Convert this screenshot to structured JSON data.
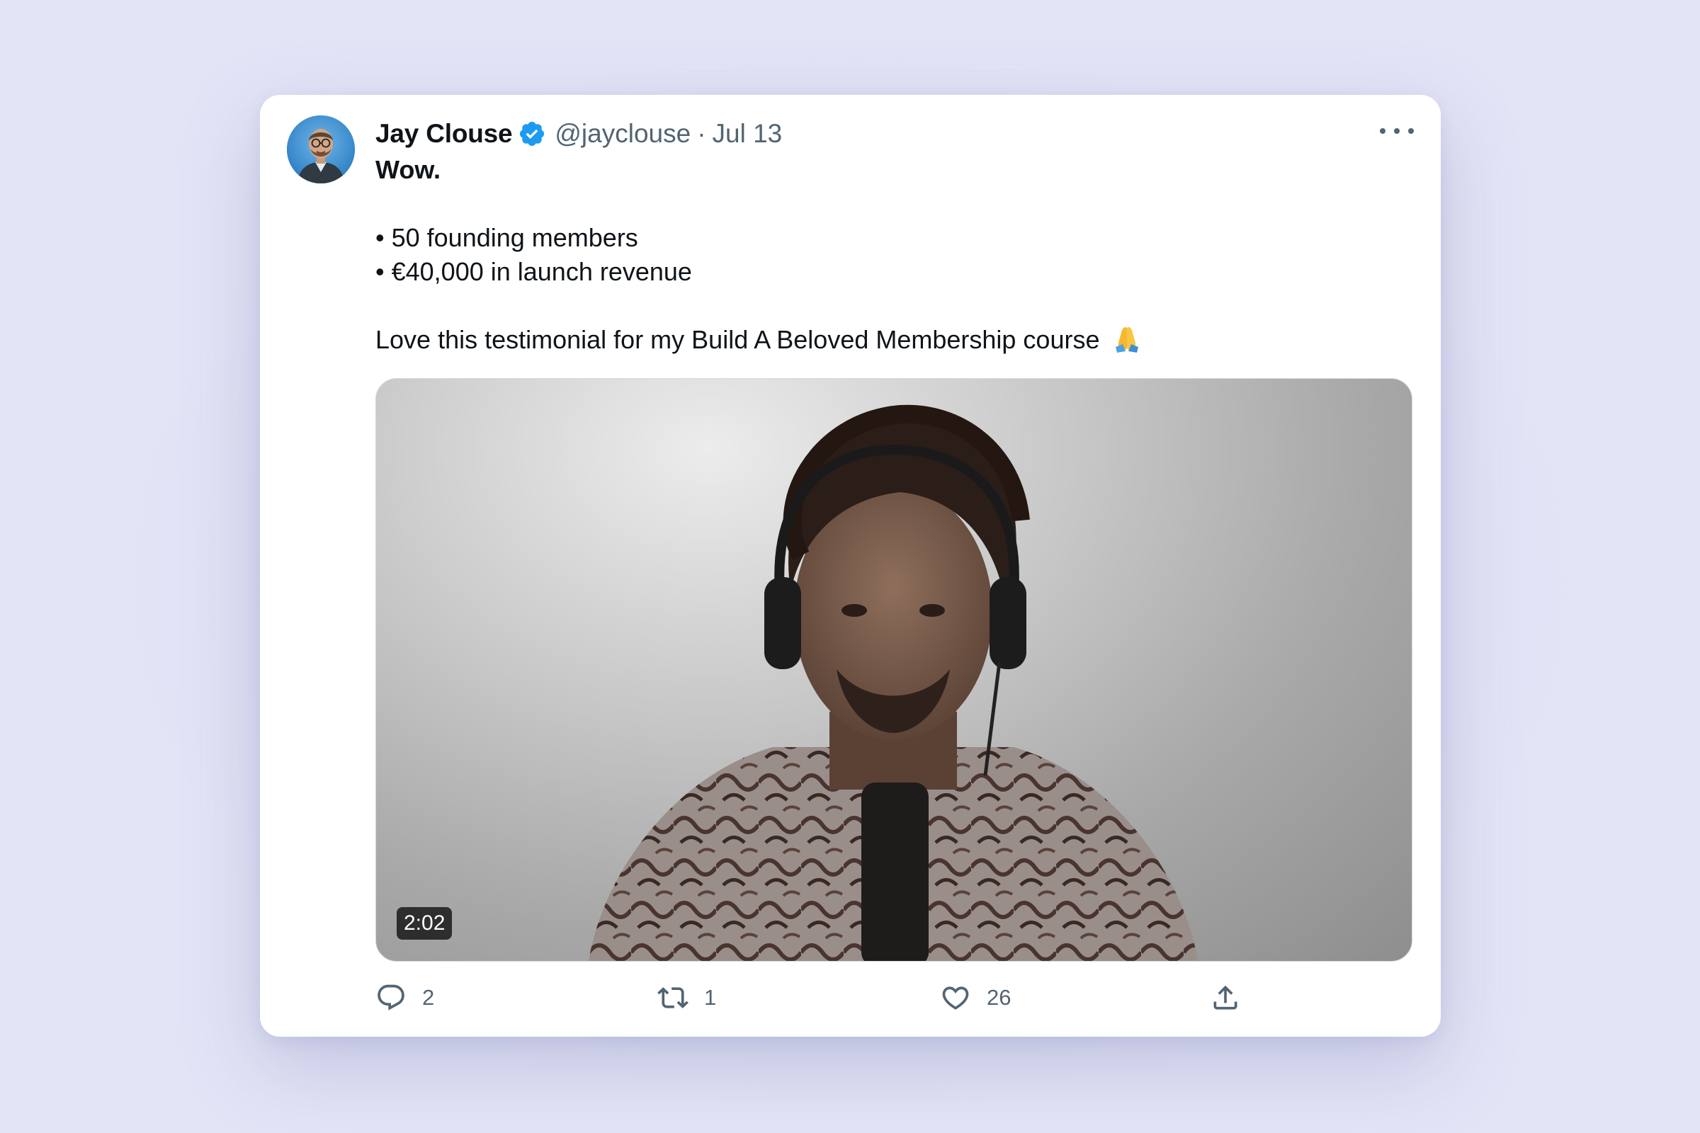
{
  "tweet": {
    "author_name": "Jay Clouse",
    "handle": "@jayclouse",
    "separator": "·",
    "date": "Jul 13",
    "text_line_1": "Wow.",
    "bullet_1": "• 50 founding members",
    "bullet_2": "• €40,000 in launch revenue",
    "text_line_2": "Love this testimonial for my Build A Beloved Membership course",
    "emoji": "🙏"
  },
  "media": {
    "type": "video",
    "duration": "2:02"
  },
  "actions": {
    "replies": "2",
    "reposts": "1",
    "likes": "26"
  },
  "icons": {
    "verified": "verified-badge-icon",
    "more": "more-horizontal-icon",
    "reply": "reply-icon",
    "repost": "repost-icon",
    "like": "heart-icon",
    "share": "share-icon"
  },
  "colors": {
    "background": "#e3e4f6",
    "card": "#ffffff",
    "verified": "#1d9bf0",
    "text_primary": "#0f1419",
    "text_secondary": "#536471"
  }
}
